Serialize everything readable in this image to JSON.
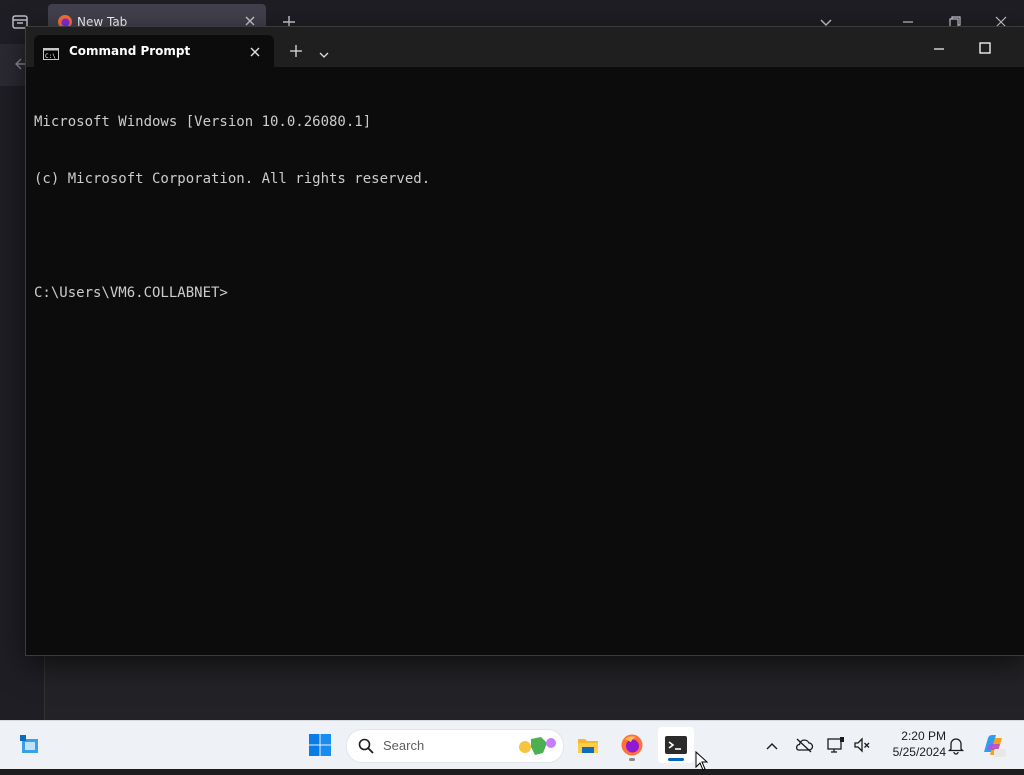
{
  "browser": {
    "tab_title": "New Tab"
  },
  "terminal": {
    "tab_title": "Command Prompt",
    "lines": [
      "Microsoft Windows [Version 10.0.26080.1]",
      "(c) Microsoft Corporation. All rights reserved.",
      "",
      "C:\\Users\\VM6.COLLABNET>"
    ],
    "colors": {
      "background": "#0c0c0c",
      "text": "#cccccc"
    }
  },
  "taskbar": {
    "search_placeholder": "Search",
    "time": "2:20 PM",
    "date": "5/25/2024",
    "pinned_apps": [
      "file-explorer-icon",
      "firefox-icon",
      "terminal-icon"
    ],
    "active_app": "terminal",
    "accent": "#0067c0"
  }
}
